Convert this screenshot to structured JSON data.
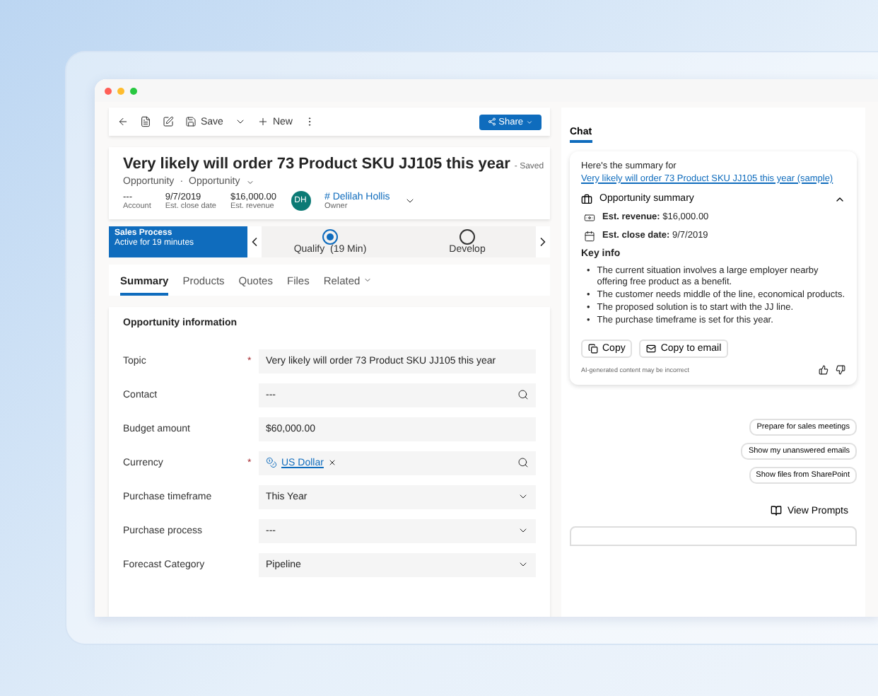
{
  "toolbar": {
    "save": "Save",
    "new": "New",
    "share": "Share"
  },
  "record": {
    "title": "Very likely will order 73 Product SKU JJ105 this year",
    "status": "- Saved",
    "entity": "Opportunity",
    "separator": "·",
    "form": "Opportunity",
    "facts": [
      {
        "value": "---",
        "label": "Account"
      },
      {
        "value": "9/7/2019",
        "label": "Est. close date"
      },
      {
        "value": "$16,000.00",
        "label": "Est. revenue"
      }
    ],
    "owner": {
      "initials": "DH",
      "name": "# Delilah Hollis",
      "role": "Owner"
    }
  },
  "process": {
    "name": "Sales Process",
    "duration": "Active for 19 minutes",
    "stages": [
      {
        "label": "Qualify  (19 Min)",
        "selected": true
      },
      {
        "label": "Develop",
        "selected": false
      }
    ]
  },
  "tabs": [
    {
      "label": "Summary",
      "selected": true
    },
    {
      "label": "Products",
      "selected": false
    },
    {
      "label": "Quotes",
      "selected": false
    },
    {
      "label": "Files",
      "selected": false
    },
    {
      "label": "Related",
      "selected": false
    }
  ],
  "section": {
    "title": "Opportunity information",
    "required_symbol": "*",
    "fields": [
      {
        "label": "Topic",
        "required": true,
        "kind": "text",
        "value": "Very likely will order 73 Product SKU JJ105 this year"
      },
      {
        "label": "Contact",
        "required": false,
        "kind": "lookup",
        "value": "---"
      },
      {
        "label": "Budget amount",
        "required": false,
        "kind": "text",
        "value": "$60,000.00"
      },
      {
        "label": "Currency",
        "required": true,
        "kind": "tag",
        "value": "US Dollar"
      },
      {
        "label": "Purchase timeframe",
        "required": false,
        "kind": "select",
        "value": "This Year"
      },
      {
        "label": "Purchase process",
        "required": false,
        "kind": "select",
        "value": "---"
      },
      {
        "label": "Forecast Category",
        "required": false,
        "kind": "select",
        "value": "Pipeline"
      }
    ]
  },
  "chat": {
    "tab": "Chat",
    "intro": "Here's the summary for ",
    "link": "Very likely will order 73 Product SKU JJ105 this year (sample)",
    "summary": {
      "title": "Opportunity summary",
      "expanded": true,
      "revenue_label": "Est. revenue:",
      "revenue": "$16,000.00",
      "close_label": "Est. close date:",
      "close": "9/7/2019"
    },
    "key_info": "Key info",
    "bullet": "•",
    "bullets": [
      "The current situation involves a large employer nearby offering free product as a benefit.",
      "The customer needs middle of the line, economical products.",
      "The proposed solution is to start with the JJ line.",
      "The purchase timeframe is set for this year."
    ],
    "copy": "Copy",
    "copy_email": "Copy to email",
    "disclaimer": "AI-generated content may be incorrect",
    "suggestions": [
      "Prepare for sales meetings",
      "Show my unanswered emails",
      "Show files from SharePoint"
    ],
    "view_prompts": "View Prompts"
  }
}
